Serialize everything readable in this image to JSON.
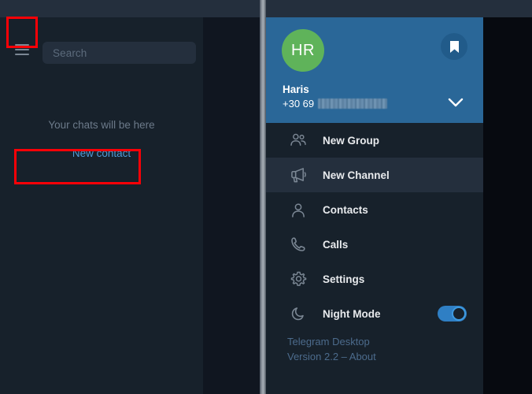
{
  "window": {
    "titlebar_color": "#242f3d"
  },
  "left_panel": {
    "menu_button_icon": "hamburger-icon",
    "search": {
      "placeholder": "Search",
      "value": ""
    },
    "empty_state": "Your chats will be here",
    "new_contact_link": "New contact"
  },
  "menu": {
    "profile": {
      "avatar_initials": "HR",
      "avatar_color": "#5fb35a",
      "name": "Haris",
      "phone_prefix": "+30 69",
      "phone_redacted": true,
      "header_color": "#2a6798",
      "bookmark_icon": "bookmark-icon",
      "expand_icon": "chevron-down-icon"
    },
    "items": [
      {
        "label": "New Group",
        "icon": "people-icon",
        "active": false
      },
      {
        "label": "New Channel",
        "icon": "megaphone-icon",
        "active": true
      },
      {
        "label": "Contacts",
        "icon": "person-icon",
        "active": false
      },
      {
        "label": "Calls",
        "icon": "phone-icon",
        "active": false
      },
      {
        "label": "Settings",
        "icon": "gear-icon",
        "active": false
      },
      {
        "label": "Night Mode",
        "icon": "moon-icon",
        "active": false,
        "toggle": "on"
      }
    ],
    "footer": {
      "app_name": "Telegram Desktop",
      "version_line": "Version 2.2 – About"
    }
  },
  "annotations": {
    "highlight_color": "#fb0007",
    "boxes": [
      "hamburger-button",
      "new-channel-menu-item"
    ]
  }
}
